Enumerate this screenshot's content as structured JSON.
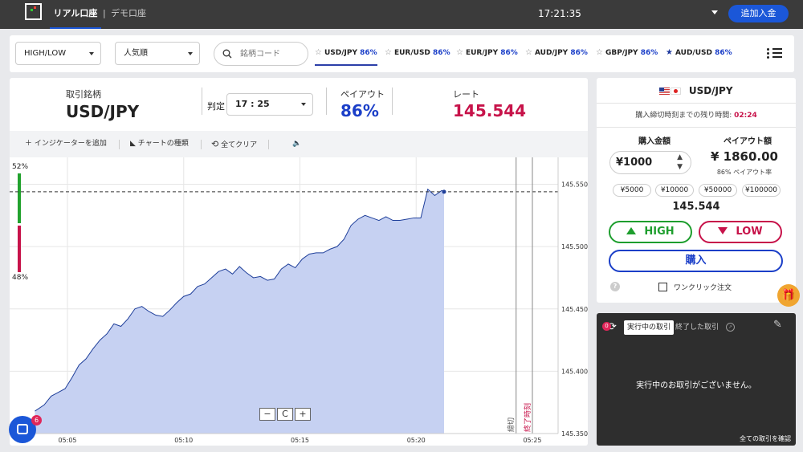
{
  "topbar": {
    "real_account": "リアル口座",
    "separator": "|",
    "demo_account": "デモ口座",
    "clock": "17:21:35",
    "deposit_button": "追加入金"
  },
  "filters": {
    "trade_type": "HIGH/LOW",
    "sort": "人気順",
    "search_placeholder": "銘柄コード"
  },
  "pair_tabs": [
    {
      "symbol": "USD/JPY",
      "payout": "86%",
      "favorite": false,
      "active": true
    },
    {
      "symbol": "EUR/USD",
      "payout": "86%",
      "favorite": false,
      "active": false
    },
    {
      "symbol": "EUR/JPY",
      "payout": "86%",
      "favorite": false,
      "active": false
    },
    {
      "symbol": "AUD/JPY",
      "payout": "86%",
      "favorite": false,
      "active": false
    },
    {
      "symbol": "GBP/JPY",
      "payout": "86%",
      "favorite": false,
      "active": false
    },
    {
      "symbol": "AUD/USD",
      "payout": "86%",
      "favorite": true,
      "active": false
    }
  ],
  "info": {
    "symbol_label": "取引銘柄",
    "symbol": "USD/JPY",
    "expiry_label": "判定",
    "expiry_value": "17 : 25",
    "payout_label": "ペイアウト",
    "payout_value": "86%",
    "rate_label": "レート",
    "rate_value": "145.544"
  },
  "chart_toolbar": {
    "add_indicator": "インジケーターを追加",
    "chart_type": "チャートの種類",
    "clear_all": "全てクリア"
  },
  "chart": {
    "high_pct": "52%",
    "low_pct": "48%",
    "y_ticks": [
      "145.550",
      "145.500",
      "145.450",
      "145.400",
      "145.350"
    ],
    "x_ticks": [
      "05:05",
      "05:10",
      "05:15",
      "05:20",
      "05:25"
    ],
    "close_label": "締切",
    "end_label": "終了時刻",
    "zoom_out": "−",
    "zoom_reset": "C",
    "zoom_in": "+"
  },
  "chart_data": {
    "type": "area",
    "ylim": [
      145.35,
      145.56
    ],
    "y_ticks": [
      145.55,
      145.5,
      145.45,
      145.4,
      145.35
    ],
    "x_ticks": [
      "05:05",
      "05:10",
      "05:15",
      "05:20",
      "05:25"
    ],
    "current_rate": 145.544,
    "x_minutes": [
      3.6,
      4.0,
      4.3,
      4.6,
      4.9,
      5.2,
      5.5,
      5.8,
      6.1,
      6.4,
      6.7,
      7.0,
      7.3,
      7.6,
      7.9,
      8.2,
      8.5,
      8.8,
      9.1,
      9.4,
      9.7,
      10.0,
      10.3,
      10.6,
      10.9,
      11.2,
      11.5,
      11.8,
      12.1,
      12.4,
      12.7,
      13.0,
      13.3,
      13.6,
      13.9,
      14.2,
      14.5,
      14.8,
      15.1,
      15.4,
      15.7,
      16.0,
      16.3,
      16.6,
      16.9,
      17.2,
      17.5,
      17.8,
      18.1,
      18.4,
      18.7,
      19.0,
      19.3,
      19.6,
      19.9,
      20.2,
      20.5,
      20.8,
      21.1,
      21.2
    ],
    "values": [
      145.368,
      145.373,
      145.38,
      145.383,
      145.386,
      145.395,
      145.405,
      145.41,
      145.418,
      145.425,
      145.43,
      145.438,
      145.436,
      145.442,
      145.45,
      145.452,
      145.448,
      145.445,
      145.444,
      145.449,
      145.455,
      145.46,
      145.462,
      145.468,
      145.47,
      145.475,
      145.48,
      145.482,
      145.478,
      145.484,
      145.479,
      145.475,
      145.476,
      145.473,
      145.474,
      145.482,
      145.486,
      145.483,
      145.49,
      145.494,
      145.495,
      145.495,
      145.498,
      145.5,
      145.506,
      145.517,
      145.522,
      145.525,
      145.523,
      145.521,
      145.524,
      145.521,
      145.521,
      145.522,
      145.523,
      145.523,
      145.546,
      145.541,
      145.545,
      145.544
    ],
    "close_minute": 24.3,
    "end_minute": 25.0
  },
  "trade_panel": {
    "symbol": "USD/JPY",
    "remaining_label": "購入締切時刻までの残り時間:",
    "remaining_time": "02:24",
    "amount_label": "購入金額",
    "payout_label": "ペイアウト額",
    "amount_value": "¥1000",
    "payout_amount": "¥ 1860.00",
    "payout_rate_note": "86% ペイアウト率",
    "quick_amounts": [
      "¥5000",
      "¥10000",
      "¥50000",
      "¥100000"
    ],
    "rate": "145.544",
    "high_button": "HIGH",
    "low_button": "LOW",
    "buy_button": "購入",
    "help": "?",
    "one_click": "ワンクリック注文"
  },
  "trades_panel": {
    "badge": "0",
    "active_tab": "実行中の取引",
    "ended_tab": "終了した取引",
    "empty_message": "実行中のお取引がございません。",
    "view_all": "全ての取引を確認"
  },
  "chat": {
    "badge": "6"
  },
  "colors": {
    "brand_blue": "#1b57d8",
    "high_green": "#1e9e2e",
    "low_red": "#c7134a",
    "payout_blue": "#1b3fc8",
    "area_fill": "#c6d1f2",
    "line": "#1f3f9a"
  }
}
